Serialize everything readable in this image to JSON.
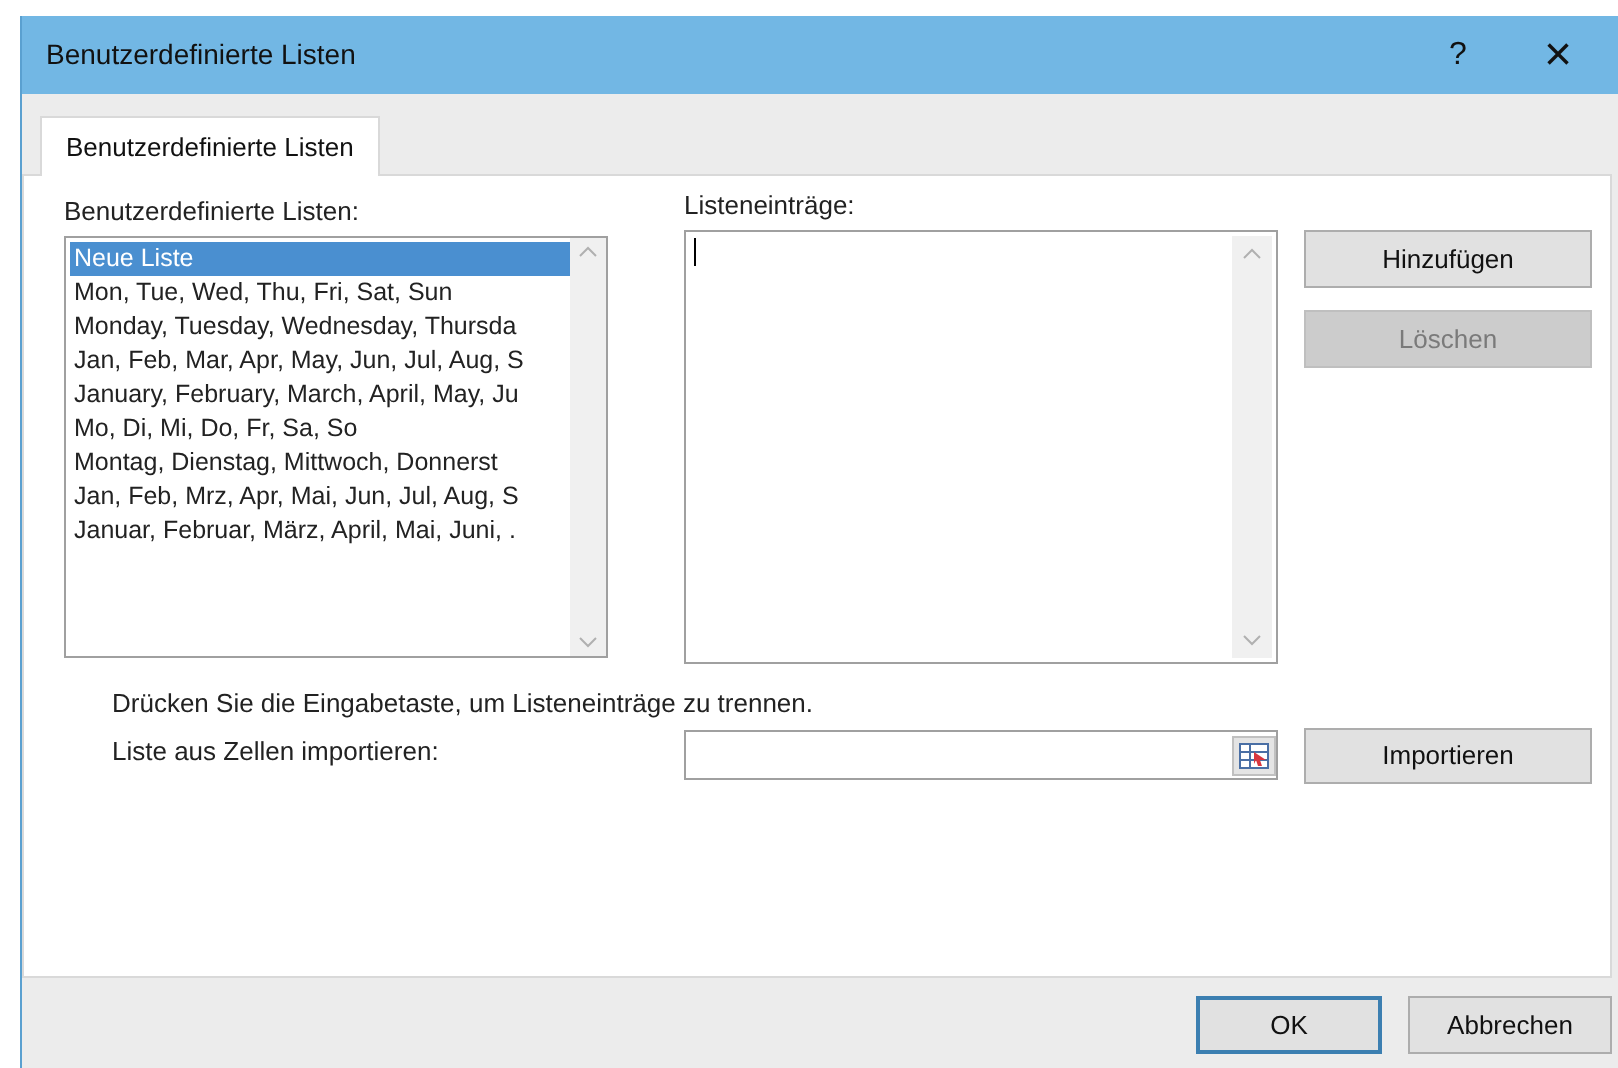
{
  "window": {
    "title": "Benutzerdefinierte Listen",
    "help": "?",
    "close": "×"
  },
  "tabs": [
    {
      "label": "Benutzerdefinierte Listen",
      "selected": true
    }
  ],
  "lists": {
    "label": "Benutzerdefinierte Listen:",
    "items": [
      {
        "label": "Neue Liste",
        "selected": true
      },
      {
        "label": "Mon, Tue, Wed, Thu, Fri, Sat, Sun",
        "selected": false
      },
      {
        "label": "Monday, Tuesday, Wednesday, Thursda",
        "selected": false
      },
      {
        "label": "Jan, Feb, Mar, Apr, May, Jun, Jul, Aug, S",
        "selected": false
      },
      {
        "label": "January, February, March, April, May, Ju",
        "selected": false
      },
      {
        "label": "Mo, Di, Mi, Do, Fr, Sa, So",
        "selected": false
      },
      {
        "label": "Montag, Dienstag, Mittwoch, Donnerst",
        "selected": false
      },
      {
        "label": "Jan, Feb, Mrz, Apr, Mai, Jun, Jul, Aug, S",
        "selected": false
      },
      {
        "label": "Januar, Februar, März, April, Mai, Juni, .",
        "selected": false
      }
    ]
  },
  "entries": {
    "label": "Listeneinträge:"
  },
  "side_buttons": [
    {
      "label": "Hinzufügen",
      "disabled": false
    },
    {
      "label": "Löschen",
      "disabled": true
    }
  ],
  "hint": "Drücken Sie die Eingabetaste, um Listeneinträge zu trennen.",
  "import": {
    "label": "Liste aus Zellen importieren:",
    "button": "Importieren"
  },
  "buttons": [
    {
      "label": "OK",
      "default": true
    },
    {
      "label": "Abbrechen",
      "default": false
    }
  ]
}
